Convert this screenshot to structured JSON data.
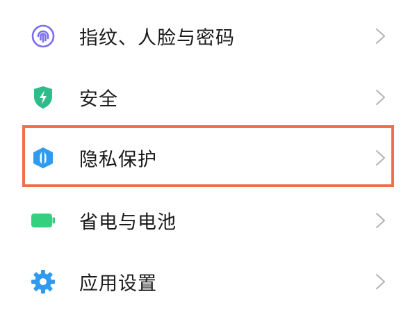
{
  "settings": {
    "items": [
      {
        "label": "指纹、人脸与密码",
        "icon": "fingerprint-icon",
        "icon_color": "#7b6df2"
      },
      {
        "label": "安全",
        "icon": "shield-bolt-icon",
        "icon_color": "#2ebc8a"
      },
      {
        "label": "隐私保护",
        "icon": "privacy-shield-icon",
        "icon_color": "#2e9bf0"
      },
      {
        "label": "省电与电池",
        "icon": "battery-icon",
        "icon_color": "#35d07f"
      },
      {
        "label": "应用设置",
        "icon": "gear-icon",
        "icon_color": "#2e9bf0"
      }
    ],
    "highlight_color": "#ee7048",
    "chevron_color": "#b3b3b3"
  }
}
